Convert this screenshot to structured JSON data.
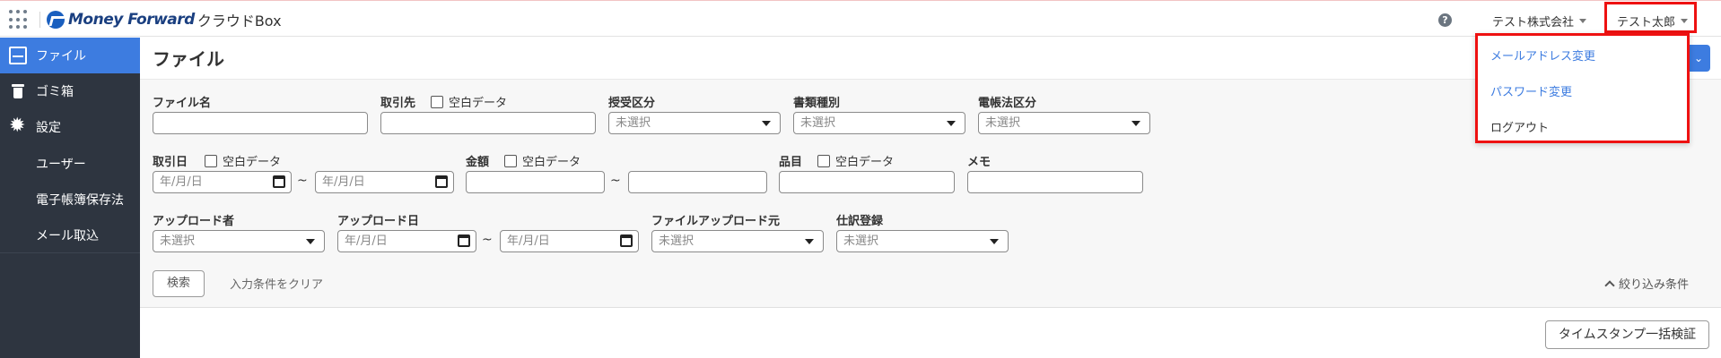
{
  "header": {
    "brand": "Money Forward",
    "product": "クラウドBox",
    "help_icon": "?",
    "company": "テスト株式会社",
    "user": "テスト太郎"
  },
  "sidebar": {
    "items": [
      {
        "label": "ファイル",
        "icon": "file-icon",
        "active": true
      },
      {
        "label": "ゴミ箱",
        "icon": "trash-icon"
      },
      {
        "label": "設定",
        "icon": "gear-icon"
      }
    ],
    "sub_items": [
      "ユーザー",
      "電子帳簿保存法",
      "メール取込"
    ]
  },
  "main": {
    "title": "ファイル"
  },
  "filters": {
    "file_name": {
      "label": "ファイル名"
    },
    "partner": {
      "label": "取引先",
      "blank_label": "空白データ"
    },
    "payment_type": {
      "label": "授受区分",
      "placeholder": "未選択"
    },
    "doc_type": {
      "label": "書類種別",
      "placeholder": "未選択"
    },
    "edl_type": {
      "label": "電帳法区分",
      "placeholder": "未選択"
    },
    "trade_date": {
      "label": "取引日",
      "blank_label": "空白データ",
      "from_placeholder": "年/月/日",
      "to_placeholder": "年/月/日"
    },
    "amount": {
      "label": "金額",
      "blank_label": "空白データ"
    },
    "item": {
      "label": "品目",
      "blank_label": "空白データ"
    },
    "memo": {
      "label": "メモ"
    },
    "uploader": {
      "label": "アップロード者",
      "placeholder": "未選択"
    },
    "upload_date": {
      "label": "アップロード日",
      "from_placeholder": "年/月/日",
      "to_placeholder": "年/月/日"
    },
    "upload_source": {
      "label": "ファイルアップロード元",
      "placeholder": "未選択"
    },
    "journal": {
      "label": "仕訳登録",
      "placeholder": "未選択"
    },
    "tilde": "~",
    "search_label": "検索",
    "clear_label": "入力条件をクリア",
    "collapse_label": "絞り込み条件"
  },
  "timestamp_button": "タイムスタンプ一括検証",
  "dropdown": {
    "items": [
      {
        "label": "メールアドレス変更",
        "color": "#3d7ce0"
      },
      {
        "label": "パスワード変更",
        "color": "#3d7ce0"
      },
      {
        "label": "ログアウト",
        "color": "#333333"
      }
    ]
  }
}
